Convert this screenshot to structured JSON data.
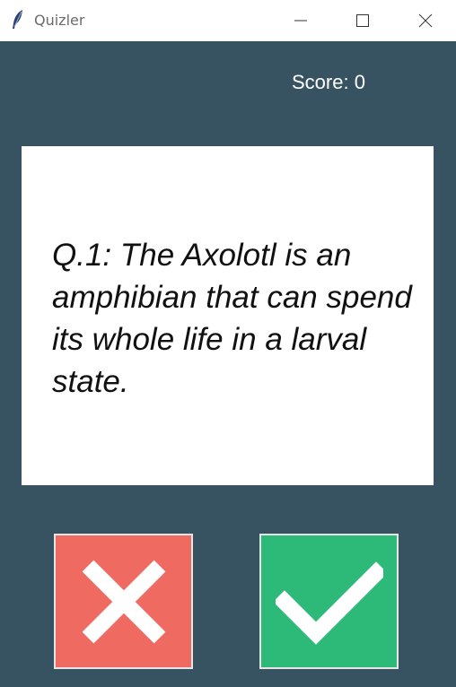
{
  "window": {
    "title": "Quizler",
    "controls": {
      "minimize_icon": "minimize-icon",
      "maximize_icon": "maximize-icon",
      "close_icon": "close-icon"
    }
  },
  "score": {
    "label": "Score: 0"
  },
  "question": {
    "text": "Q.1: The Axolotl is an amphibian that can spend its whole life in a larval state."
  },
  "buttons": {
    "false_icon": "cross-icon",
    "true_icon": "check-icon",
    "false_color": "#ef6a61",
    "true_color": "#2db977"
  },
  "colors": {
    "background": "#375362",
    "card": "#ffffff"
  }
}
